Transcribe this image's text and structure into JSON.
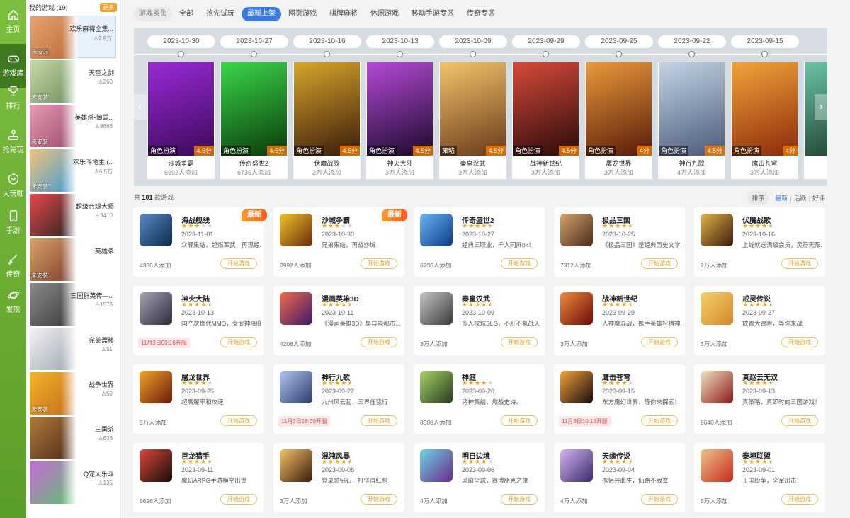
{
  "nav": [
    {
      "label": "主页",
      "icon": "home-icon"
    },
    {
      "label": "游戏库",
      "icon": "gamepad-icon",
      "active": true
    },
    {
      "label": "排行",
      "icon": "trophy-icon"
    },
    {
      "label": "抢先玩",
      "icon": "joystick-icon"
    },
    {
      "label": "大玩咖",
      "icon": "shield-icon"
    },
    {
      "label": "手游",
      "icon": "phone-icon"
    },
    {
      "label": "传奇",
      "icon": "sword-icon"
    },
    {
      "label": "发现",
      "icon": "planet-icon"
    }
  ],
  "my_games": {
    "title": "我的游戏 (19)",
    "more": "更多",
    "items": [
      {
        "name": "欢乐麻将全集...",
        "count": "2.9万",
        "tag": "未安装",
        "colors": [
          "#e8a36c",
          "#b86a3a"
        ]
      },
      {
        "name": "天空之剑",
        "count": "260",
        "tag": "未安装",
        "colors": [
          "#c9d9a9",
          "#6c8f5a"
        ]
      },
      {
        "name": "英雄杀-御驾...",
        "count": "8866",
        "tag": "未安装",
        "colors": [
          "#e89ab4",
          "#9b4a6a"
        ]
      },
      {
        "name": "欢乐斗地主 (...",
        "count": "6.5万",
        "tag": "未安装",
        "colors": [
          "#f2c37a",
          "#3a9ad6"
        ]
      },
      {
        "name": "超级台球大师",
        "count": "3410",
        "tag": "",
        "colors": [
          "#e84a4a",
          "#222222"
        ]
      },
      {
        "name": "英雄杀",
        "count": "",
        "tag": "未安装",
        "colors": [
          "#d9a36a",
          "#7a3a2a"
        ]
      },
      {
        "name": "三国群英传—...",
        "count": "1573",
        "tag": "",
        "colors": [
          "#8a8a8a",
          "#3a3a3a"
        ]
      },
      {
        "name": "完美漂移",
        "count": "51",
        "tag": "",
        "colors": [
          "#f4f4f4",
          "#9aa4b0"
        ]
      },
      {
        "name": "战争世界",
        "count": "59",
        "tag": "未安装",
        "colors": [
          "#f2b42a",
          "#c46a1a"
        ]
      },
      {
        "name": "三国杀",
        "count": "636",
        "tag": "",
        "colors": [
          "#b07a3a",
          "#4a2a1a"
        ]
      },
      {
        "name": "Q宠大乐斗",
        "count": "135",
        "tag": "",
        "colors": [
          "#c86ad6",
          "#5ac46a"
        ]
      }
    ]
  },
  "categories": {
    "label": "游戏类型",
    "items": [
      "全部",
      "抢先试玩",
      "最新上架",
      "网页游戏",
      "棋牌麻将",
      "休闲游戏",
      "移动手游专区",
      "传奇专区"
    ],
    "active_index": 2
  },
  "timeline": [
    {
      "date": "2023-10-30",
      "name": "沙城争霸",
      "added": "6992人添加",
      "genre": "角色扮演",
      "score": "4.5分",
      "colors": [
        "#9a2ad6",
        "#3a0a5a"
      ]
    },
    {
      "date": "2023-10-27",
      "name": "传奇盛世2",
      "added": "6736人添加",
      "genre": "角色扮演",
      "score": "4.5分",
      "colors": [
        "#3ad64a",
        "#0a3a0a"
      ]
    },
    {
      "date": "2023-10-16",
      "name": "伏魔战歌",
      "added": "2万人添加",
      "genre": "角色扮演",
      "score": "4.5分",
      "colors": [
        "#d6a62a",
        "#3a1a0a"
      ]
    },
    {
      "date": "2023-10-13",
      "name": "神火大陆",
      "added": "3万人添加",
      "genre": "角色扮演",
      "score": "4.5分",
      "colors": [
        "#b44ad6",
        "#1a0a2a"
      ]
    },
    {
      "date": "2023-10-09",
      "name": "秦皇汉武",
      "added": "3万人添加",
      "genre": "策略",
      "score": "4.5分",
      "colors": [
        "#f2c46a",
        "#6a3a1a"
      ]
    },
    {
      "date": "2023-09-29",
      "name": "战神新世纪",
      "added": "3万人添加",
      "genre": "角色扮演",
      "score": "4.5分",
      "colors": [
        "#d64a3a",
        "#2a0a0a"
      ]
    },
    {
      "date": "2023-09-25",
      "name": "屠龙世界",
      "added": "3万人添加",
      "genre": "角色扮演",
      "score": "4分",
      "colors": [
        "#e89a3a",
        "#5a1a0a"
      ]
    },
    {
      "date": "2023-09-22",
      "name": "神行九歌",
      "added": "4万人添加",
      "genre": "角色扮演",
      "score": "4.5分",
      "colors": [
        "#c4d4e4",
        "#4a5a7a"
      ]
    },
    {
      "date": "2023-09-15",
      "name": "鹰击苍穹",
      "added": "3万人添加",
      "genre": "角色扮演",
      "score": "4分",
      "colors": [
        "#f2a43a",
        "#8a2a0a"
      ]
    }
  ],
  "total": {
    "prefix": "共",
    "count": "101",
    "suffix": "款游戏"
  },
  "sort": {
    "label": "排序",
    "options": [
      "最新",
      "活跃",
      "好评"
    ],
    "active_index": 0
  },
  "games": [
    {
      "name": "海战舰线",
      "date": "2023-11-01",
      "desc": "众舰集结，超燃军武，再现经...",
      "added": "4336人添加",
      "rating": 3,
      "badge": "最新",
      "sched": "",
      "colors": [
        "#5a8ac4",
        "#0a2a4a"
      ]
    },
    {
      "name": "沙城争霸",
      "date": "2023-10-30",
      "desc": "兄弟集结，再战沙城",
      "added": "6992人添加",
      "rating": 3,
      "badge": "最新",
      "sched": "",
      "colors": [
        "#f2c42a",
        "#6a2a0a"
      ]
    },
    {
      "name": "传奇盛世2",
      "date": "2023-10-27",
      "desc": "经典三职业，千人同屏pk！",
      "added": "6736人添加",
      "rating": 4.5,
      "badge": "",
      "sched": "",
      "colors": [
        "#6ab4f2",
        "#0a3a8a"
      ]
    },
    {
      "name": "极品三国",
      "date": "2023-10-25",
      "desc": "《极品三国》是经典历史文学...",
      "added": "7312人添加",
      "rating": 4.5,
      "badge": "",
      "sched": "",
      "colors": [
        "#d6a46a",
        "#4a2a1a"
      ]
    },
    {
      "name": "伏魔战歌",
      "date": "2023-10-16",
      "desc": "上线就送满级会员，灵符无限...",
      "added": "2万人添加",
      "rating": 4.5,
      "badge": "",
      "sched": "",
      "colors": [
        "#e4b44a",
        "#3a1a0a"
      ]
    },
    {
      "name": "神火大陆",
      "date": "2023-10-13",
      "desc": "国产次世代MMO，女武神降临",
      "added": "",
      "rating": 4.5,
      "badge": "",
      "sched": "11月3日00:16开服",
      "colors": [
        "#a4a4b4",
        "#2a2a3a"
      ]
    },
    {
      "name": "漫画英雄3D",
      "date": "2023-10-11",
      "desc": "《漫画英雄3D》是异能都市...",
      "added": "4208人添加",
      "rating": 4.5,
      "badge": "",
      "sched": "",
      "colors": [
        "#f26a4a",
        "#3a1a6a"
      ]
    },
    {
      "name": "秦皇汉武",
      "date": "2023-10-09",
      "desc": "多人攻城SLG，不肝不氪战天下",
      "added": "3万人添加",
      "rating": 4.5,
      "badge": "",
      "sched": "",
      "colors": [
        "#c4c4c4",
        "#3a3a3a"
      ]
    },
    {
      "name": "战神新世纪",
      "date": "2023-09-29",
      "desc": "人神魔混战，携手英雄狩猎神...",
      "added": "3万人添加",
      "rating": 4.5,
      "badge": "",
      "sched": "",
      "colors": [
        "#f28a3a",
        "#6a0a0a"
      ]
    },
    {
      "name": "戒灵传说",
      "date": "2023-09-27",
      "desc": "放置大冒险，等你来战",
      "added": "3万人添加",
      "rating": 4.5,
      "badge": "",
      "sched": "",
      "colors": [
        "#f2d46a",
        "#d6862a"
      ]
    },
    {
      "name": "屠龙世界",
      "date": "2023-09-25",
      "desc": "超高爆率和攻速",
      "added": "3万人添加",
      "rating": 4,
      "badge": "",
      "sched": "",
      "colors": [
        "#f2a42a",
        "#6a1a0a"
      ]
    },
    {
      "name": "神行九歌",
      "date": "2023-09-22",
      "desc": "九州风云起，三界任我行",
      "added": "",
      "rating": 4.5,
      "badge": "",
      "sched": "11月3日16:00开服",
      "colors": [
        "#b4c4f2",
        "#2a3a6a"
      ]
    },
    {
      "name": "神庭",
      "date": "2023-09-20",
      "desc": "诸神集结，燃战史诗。",
      "added": "8608人添加",
      "rating": 4,
      "badge": "",
      "sched": "",
      "colors": [
        "#a4d46a",
        "#2a3a1a"
      ]
    },
    {
      "name": "鹰击苍穹",
      "date": "2023-09-15",
      "desc": "东方魔幻世界，等你来探索！",
      "added": "",
      "rating": 4,
      "badge": "",
      "sched": "11月3日10:18开服",
      "colors": [
        "#f2a43a",
        "#1a0a0a"
      ]
    },
    {
      "name": "真赵云无双",
      "date": "2023-09-13",
      "desc": "真策略，真即时的三国游戏！",
      "added": "8640人添加",
      "rating": 4.5,
      "badge": "",
      "sched": "",
      "colors": [
        "#f2e4c4",
        "#8a1a1a"
      ]
    },
    {
      "name": "巨龙猎手",
      "date": "2023-09-11",
      "desc": "魔幻ARPG手游横空出世",
      "added": "9696人添加",
      "rating": 4.5,
      "badge": "",
      "sched": "",
      "colors": [
        "#d64a3a",
        "#1a0a0a"
      ]
    },
    {
      "name": "混沌风暴",
      "date": "2023-09-08",
      "desc": "登录领钻石，打怪得红包",
      "added": "3万人添加",
      "rating": 4.5,
      "badge": "",
      "sched": "",
      "colors": [
        "#f2c46a",
        "#3a1a0a"
      ]
    },
    {
      "name": "明日边境",
      "date": "2023-09-06",
      "desc": "风靡全球，赛博朋克之旅",
      "added": "4万人添加",
      "rating": 4,
      "badge": "",
      "sched": "",
      "colors": [
        "#6ad4e4",
        "#6a2a8a"
      ]
    },
    {
      "name": "天缘传说",
      "date": "2023-09-04",
      "desc": "携侣共此生，仙路不寂寞",
      "added": "4万人添加",
      "rating": 4.5,
      "badge": "",
      "sched": "",
      "colors": [
        "#d4b4f2",
        "#3a2a6a"
      ]
    },
    {
      "name": "泰坦联盟",
      "date": "2023-09-01",
      "desc": "王国纷争，全军出击！",
      "added": "5万人添加",
      "rating": 4.5,
      "badge": "",
      "sched": "",
      "colors": [
        "#f2c48a",
        "#c42a1a"
      ]
    }
  ],
  "start_button": "开始游戏"
}
